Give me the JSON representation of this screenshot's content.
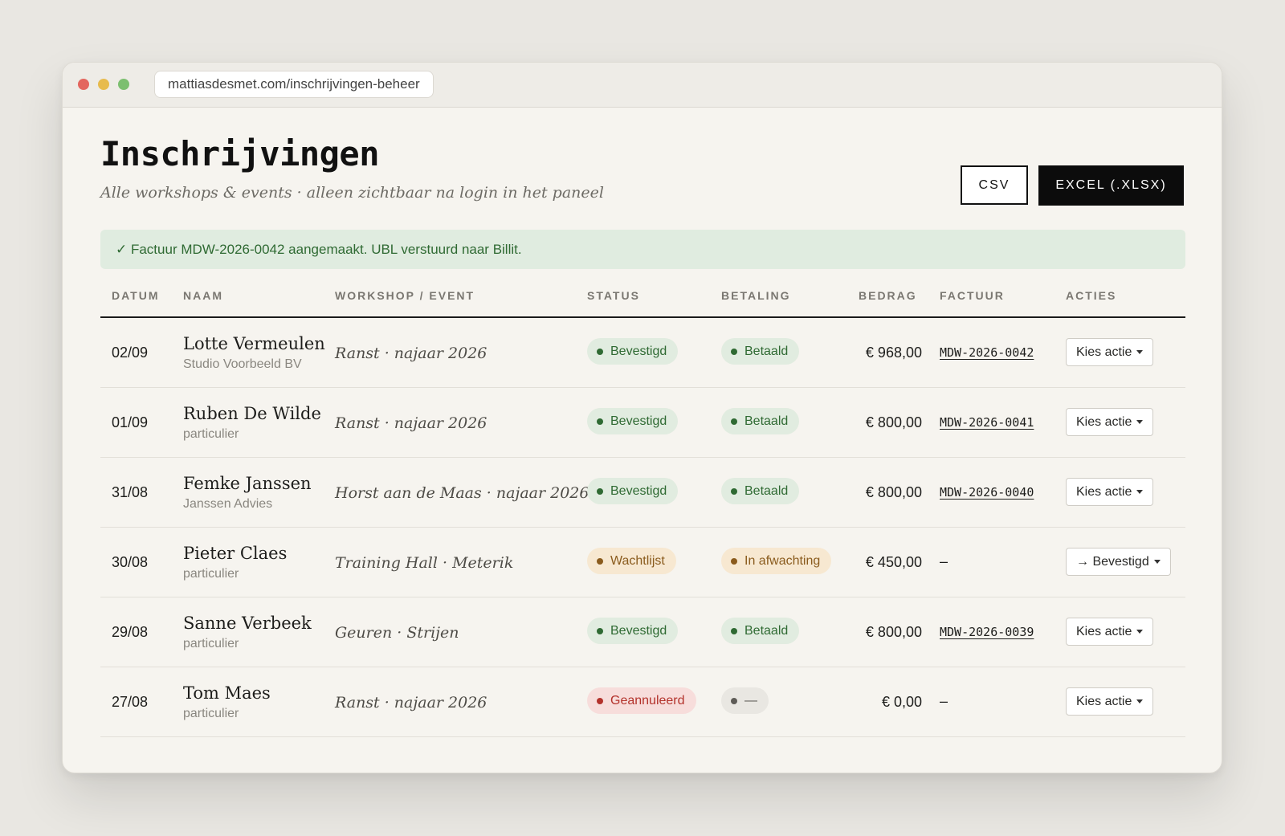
{
  "browser": {
    "url": "mattiasdesmet.com/inschrijvingen-beheer"
  },
  "header": {
    "title": "Inschrijvingen",
    "subtitle": "Alle workshops & events · alleen zichtbaar na login in het paneel",
    "csv_label": "CSV",
    "excel_label": "EXCEL (.XLSX)"
  },
  "notice": {
    "text": "✓ Factuur MDW-2026-0042 aangemaakt. UBL verstuurd naar Billit."
  },
  "table": {
    "headers": {
      "date": "DATUM",
      "name": "NAAM",
      "event": "WORKSHOP / EVENT",
      "status": "STATUS",
      "payment": "BETALING",
      "amount": "BEDRAG",
      "invoice": "FACTUUR",
      "actions": "ACTIES"
    },
    "rows": [
      {
        "date": "02/09",
        "name": "Lotte Vermeulen",
        "org": "Studio Voorbeeld BV",
        "event": "Ranst · najaar 2026",
        "status": "Bevestigd",
        "status_tone": "green",
        "payment": "Betaald",
        "payment_tone": "green",
        "amount": "€ 968,00",
        "invoice": "MDW-2026-0042",
        "action": "Kies actie"
      },
      {
        "date": "01/09",
        "name": "Ruben De Wilde",
        "org": "particulier",
        "event": "Ranst · najaar 2026",
        "status": "Bevestigd",
        "status_tone": "green",
        "payment": "Betaald",
        "payment_tone": "green",
        "amount": "€ 800,00",
        "invoice": "MDW-2026-0041",
        "action": "Kies actie"
      },
      {
        "date": "31/08",
        "name": "Femke Janssen",
        "org": "Janssen Advies",
        "event": "Horst aan de Maas · najaar 2026",
        "status": "Bevestigd",
        "status_tone": "green",
        "payment": "Betaald",
        "payment_tone": "green",
        "amount": "€ 800,00",
        "invoice": "MDW-2026-0040",
        "action": "Kies actie"
      },
      {
        "date": "30/08",
        "name": "Pieter Claes",
        "org": "particulier",
        "event": "Training Hall · Meterik",
        "status": "Wachtlijst",
        "status_tone": "amber",
        "payment": "In afwachting",
        "payment_tone": "amber",
        "amount": "€ 450,00",
        "invoice": "–",
        "action": "→ Bevestigd"
      },
      {
        "date": "29/08",
        "name": "Sanne Verbeek",
        "org": "particulier",
        "event": "Geuren · Strijen",
        "status": "Bevestigd",
        "status_tone": "green",
        "payment": "Betaald",
        "payment_tone": "green",
        "amount": "€ 800,00",
        "invoice": "MDW-2026-0039",
        "action": "Kies actie"
      },
      {
        "date": "27/08",
        "name": "Tom Maes",
        "org": "particulier",
        "event": "Ranst · najaar 2026",
        "status": "Geannuleerd",
        "status_tone": "red",
        "payment": "—",
        "payment_tone": "grey",
        "amount": "€ 0,00",
        "invoice": "–",
        "action": "Kies actie"
      }
    ]
  }
}
